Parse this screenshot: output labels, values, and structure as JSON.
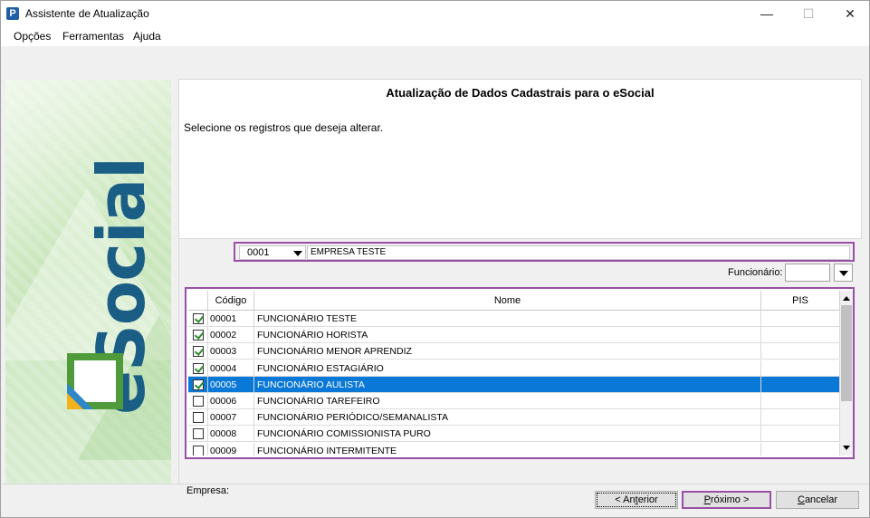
{
  "window": {
    "title": "Assistente de Atualização",
    "app_icon_letter": "P",
    "controls": {
      "minimize": "—",
      "maximize": "☐",
      "close": "✕"
    }
  },
  "menu": {
    "items": [
      "Opções",
      "Ferramentas",
      "Ajuda"
    ]
  },
  "sidebar": {
    "logo_text": "eSocial"
  },
  "content": {
    "title": "Atualização de Dados Cadastrais para o eSocial",
    "instruction": "Selecione os registros que deseja alterar."
  },
  "empresa": {
    "label": "Empresa:",
    "code": "0001",
    "name": "EMPRESA TESTE"
  },
  "funcionario": {
    "label": "Funcionário:",
    "value": ""
  },
  "grid": {
    "columns": [
      "Código",
      "Nome",
      "PIS"
    ],
    "rows": [
      {
        "checked": true,
        "code": "00001",
        "name": "FUNCIONÁRIO TESTE",
        "pis": "",
        "selected": false
      },
      {
        "checked": true,
        "code": "00002",
        "name": "FUNCIONÁRIO HORISTA",
        "pis": "",
        "selected": false
      },
      {
        "checked": true,
        "code": "00003",
        "name": "FUNCIONÁRIO MENOR APRENDIZ",
        "pis": "",
        "selected": false
      },
      {
        "checked": true,
        "code": "00004",
        "name": "FUNCIONÁRIO ESTAGIÁRIO",
        "pis": "",
        "selected": false
      },
      {
        "checked": true,
        "code": "00005",
        "name": "FUNCIONÁRIO AULISTA",
        "pis": "",
        "selected": true
      },
      {
        "checked": false,
        "code": "00006",
        "name": "FUNCIONÁRIO TAREFEIRO",
        "pis": "",
        "selected": false
      },
      {
        "checked": false,
        "code": "00007",
        "name": "FUNCIONÁRIO PERIÓDICO/SEMANALISTA",
        "pis": "",
        "selected": false
      },
      {
        "checked": false,
        "code": "00008",
        "name": "FUNCIONÁRIO COMISSIONISTA PURO",
        "pis": "",
        "selected": false
      },
      {
        "checked": false,
        "code": "00009",
        "name": "FUNCIONÁRIO INTERMITENTE",
        "pis": "",
        "selected": false
      }
    ]
  },
  "buttons": {
    "prev_pre": "< An",
    "prev_u": "t",
    "prev_post": "erior",
    "next_u": "P",
    "next_post": "róximo >",
    "cancel_u": "C",
    "cancel_post": "ancelar"
  },
  "colors": {
    "highlight_border": "#9a4fa6",
    "selection": "#0a78d7"
  }
}
